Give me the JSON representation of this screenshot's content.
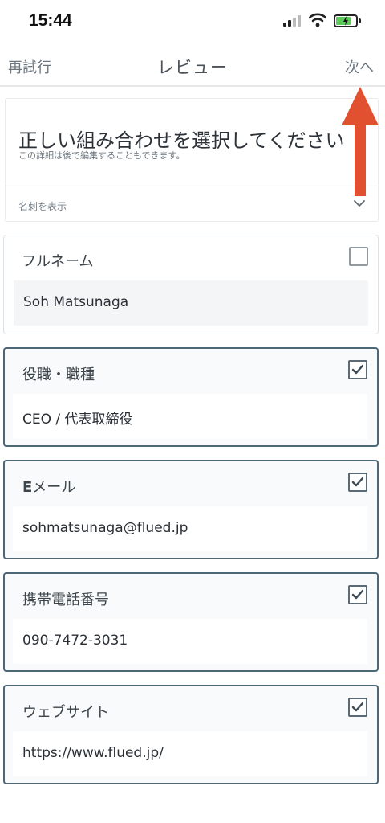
{
  "status_bar": {
    "time": "15:44",
    "colors": {
      "battery_fill": "#5cc95a"
    }
  },
  "nav": {
    "retry_label": "再試行",
    "title": "レビュー",
    "next_label": "次へ"
  },
  "instruction": {
    "heading": "正しい組み合わせを選択してください",
    "subtext": "この詳細は後で編集することもできます。",
    "show_card_label": "名刺を表示"
  },
  "fields": [
    {
      "label": "フルネーム",
      "value": "Soh Matsunaga",
      "checked": false
    },
    {
      "label_bold": "E",
      "label": "メール",
      "value": "sohmatsunaga@flued.jp",
      "checked": true
    },
    {
      "label": "役職・職種",
      "value": "CEO / 代表取締役",
      "checked": true
    },
    {
      "label": "携帯電話番号",
      "value": "090-7472-3031",
      "checked": true
    },
    {
      "label": "ウェブサイト",
      "value": "https://www.flued.jp/",
      "checked": true
    }
  ],
  "accent_colors": {
    "arrow": "#e2512f",
    "checked_border": "#4d6777"
  }
}
